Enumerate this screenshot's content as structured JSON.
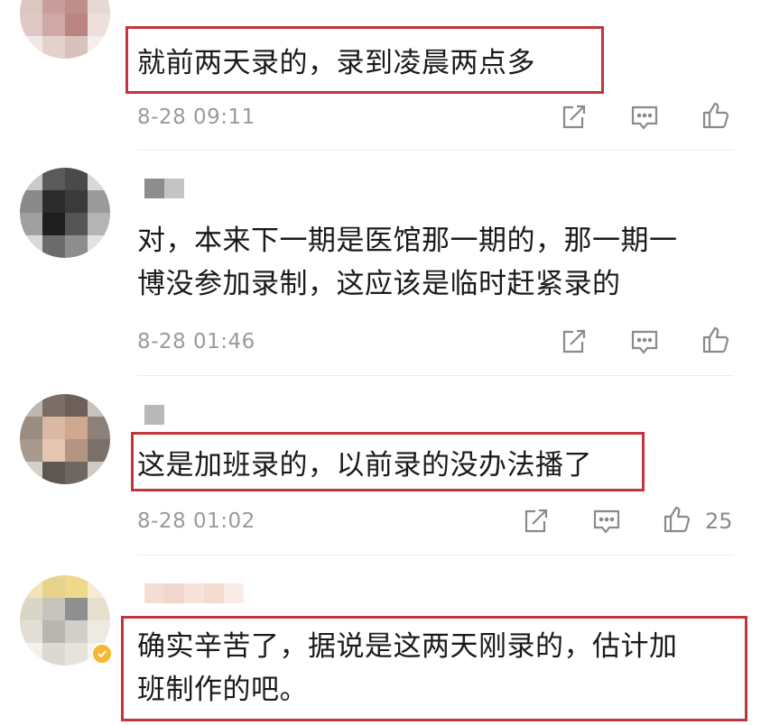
{
  "comments": [
    {
      "text": "就前两天录的，录到凌晨两点多",
      "time": "8-28 09:11",
      "likes": ""
    },
    {
      "text": "对，本来下一期是医馆那一期的，那一期一\n博没参加录制，这应该是临时赶紧录的",
      "time": "8-28 01:46",
      "likes": ""
    },
    {
      "text": "这是加班录的，以前录的没办法播了",
      "time": "8-28 01:02",
      "likes": "25"
    },
    {
      "text": "确实辛苦了，据说是这两天刚录的，估计加\n班制作的吧。",
      "time": "",
      "likes": ""
    }
  ],
  "colors": {
    "highlight_border": "#c0363c",
    "timestamp": "#9a9a9a",
    "icon_stroke": "#8a8a8a",
    "verified_badge": "#f7b731"
  },
  "icons": [
    "share-icon",
    "comment-icon",
    "like-icon",
    "verified-icon"
  ]
}
